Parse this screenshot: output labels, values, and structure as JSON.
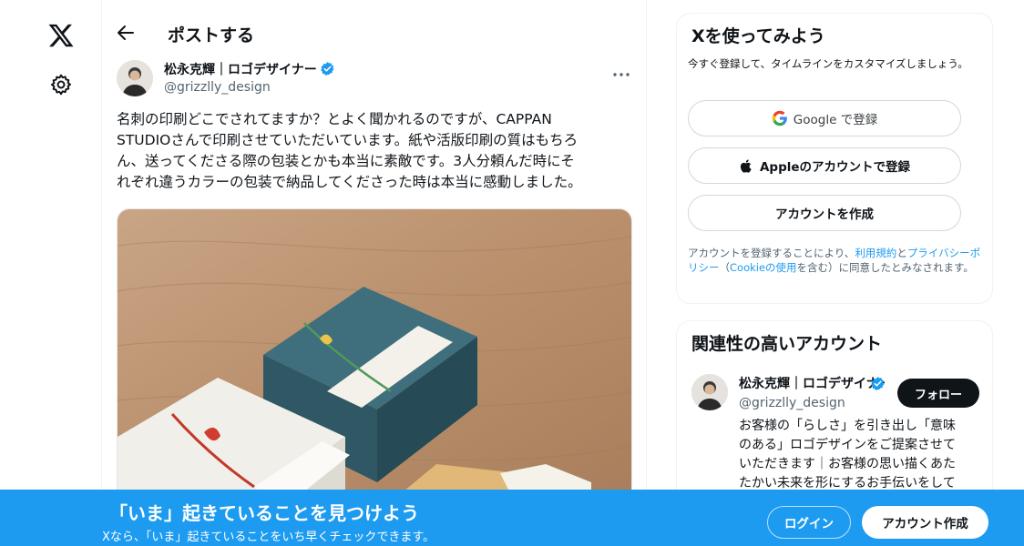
{
  "nav": {
    "logo_icon": "x-logo-icon",
    "settings_icon": "gear-icon"
  },
  "header": {
    "title": "ポストする",
    "back_icon": "arrow-left-icon"
  },
  "post": {
    "author_name": "松永克輝｜ロゴデザイナー",
    "author_handle": "@grizzlly_design",
    "verified": true,
    "more_icon": "more-horizontal-icon",
    "text_lines": [
      "名刺の印刷どこでされてますか？とよく聞かれるのですが、CAPPAN",
      "STUDIOさんで印刷させていただいています。紙や活版印刷の質はもちろ",
      "ん、送ってくださる際の包装とかも本当に素敵です。3人分頼んだ時にそ",
      "れぞれ違うカラーの包装で納品してくださった時は本当に感動しました。"
    ]
  },
  "signup_card": {
    "title": "Xを使ってみよう",
    "subtitle": "今すぐ登録して、タイムラインをカスタマイズしましょう。",
    "google_label": "Google で登録",
    "apple_label": "Appleのアカウントで登録",
    "create_label": "アカウントを作成",
    "legal_prefix": "アカウントを登録することにより、",
    "legal_terms": "利用規約",
    "legal_and": "と",
    "legal_privacy": "プライバシーポリシー",
    "legal_paren_open": "（",
    "legal_cookie": "Cookieの使用",
    "legal_suffix": "を含む）に同意したとみなされます。"
  },
  "related_card": {
    "title": "関連性の高いアカウント",
    "account_name": "松永克輝｜ロゴデザイナー",
    "account_handle": "@grizzlly_design",
    "follow_label": "フォロー",
    "bio_lines": [
      "お客様の「らしさ」を引き出し「意味",
      "のある」ロゴデザインをご提案させて",
      "いただきます｜お客様の思い描くあた",
      "たかい未来を形にするお手伝いをして"
    ]
  },
  "banner": {
    "title": "「いま」起きていることを見つけよう",
    "subtitle": "Xなら、「いま」起きていることをいち早くチェックできます。",
    "login_label": "ログイン",
    "signup_label": "アカウント作成"
  },
  "colors": {
    "accent": "#1d9bf0",
    "text": "#0f1419",
    "muted": "#536471",
    "border": "#eff3f4"
  }
}
